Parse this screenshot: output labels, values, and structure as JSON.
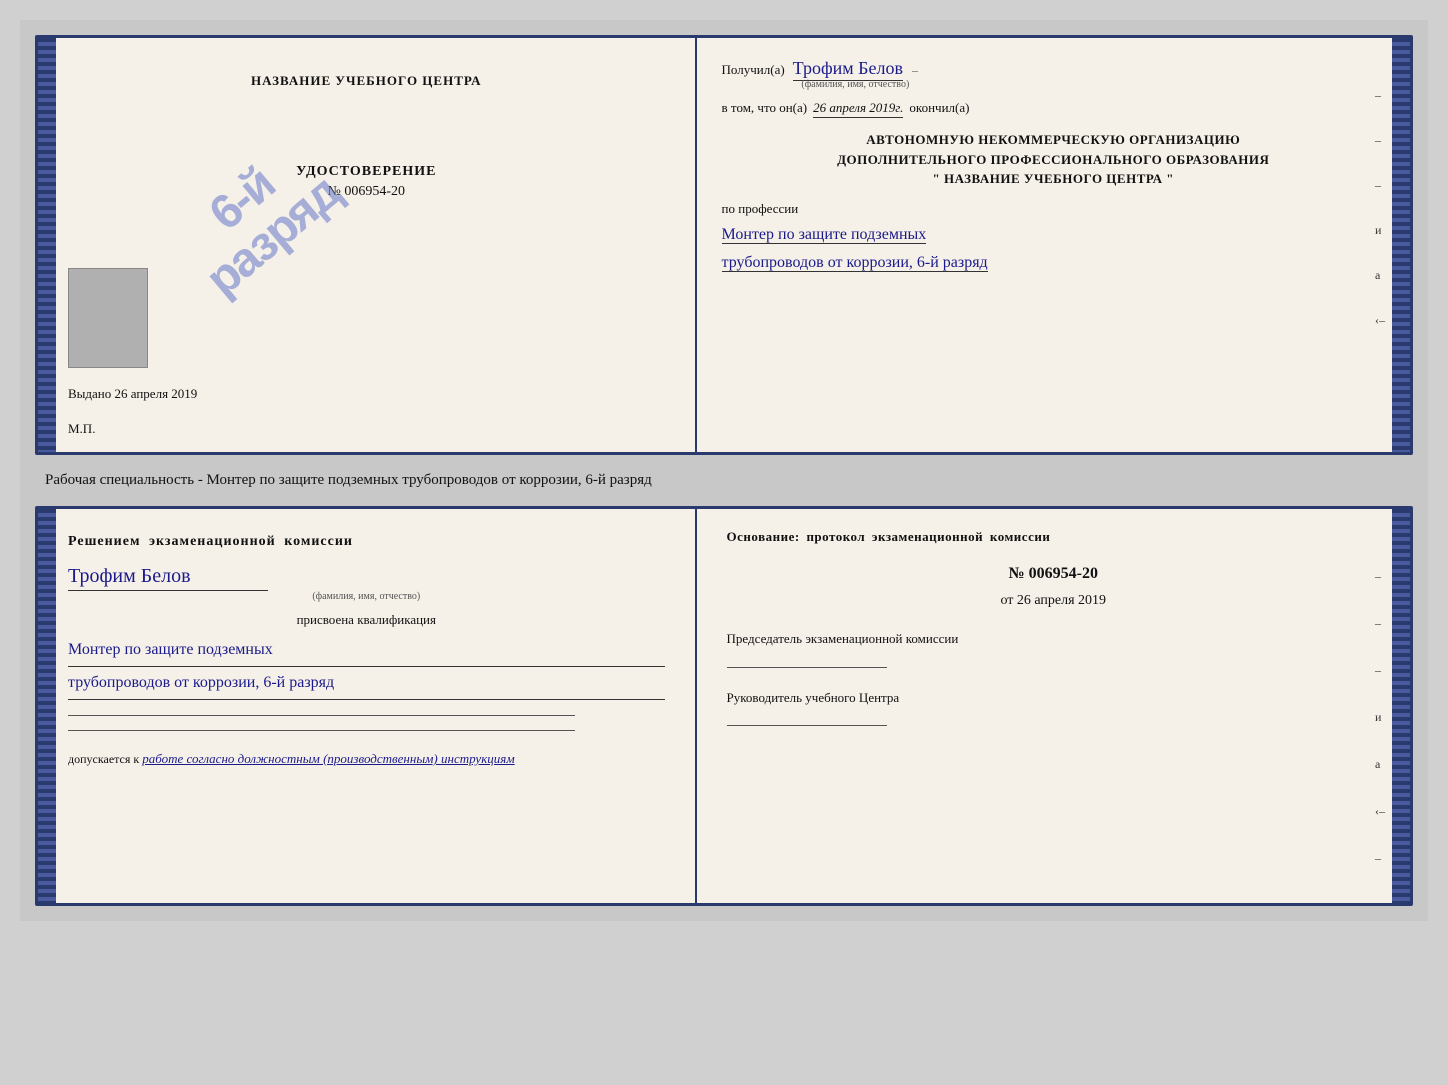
{
  "top_cert": {
    "left": {
      "title": "НАЗВАНИЕ УЧЕБНОГО ЦЕНТРА",
      "stamp_line1": "6-й",
      "stamp_line2": "разряд",
      "udost_title": "УДОСТОВЕРЕНИЕ",
      "udost_number": "№ 006954-20",
      "vydano_label": "Выдано",
      "vydano_date": "26 апреля 2019",
      "mp_label": "М.П."
    },
    "right": {
      "poluchil_label": "Получил(a)",
      "recipient_name": "Трофим Белов",
      "fio_hint": "(фамилия, имя, отчество)",
      "vtom_label": "в том, что он(а)",
      "date_written": "26 апреля 2019г.",
      "okonchil_label": "окончил(а)",
      "org_line1": "АВТОНОМНУЮ НЕКОММЕРЧЕСКУЮ ОРГАНИЗАЦИЮ",
      "org_line2": "ДОПОЛНИТЕЛЬНОГО ПРОФЕССИОНАЛЬНОГО ОБРАЗОВАНИЯ",
      "org_line3": "\"  НАЗВАНИЕ УЧЕБНОГО ЦЕНТРА  \"",
      "po_professii_label": "по профессии",
      "profession_line1": "Монтер по защите подземных",
      "profession_line2": "трубопроводов от коррозии, 6-й разряд",
      "dash1": "–",
      "dash2": "–",
      "dash3": "–",
      "i_label": "и",
      "a_label": "а",
      "arrow_label": "‹–"
    }
  },
  "middle": {
    "text": "Рабочая специальность - Монтер по защите подземных трубопроводов от коррозии, 6-й разряд"
  },
  "bottom_cert": {
    "left": {
      "resheniye_title": "Решением  экзаменационной  комиссии",
      "name": "Трофим Белов",
      "fio_hint": "(фамилия, имя, отчество)",
      "prisvoena_label": "присвоена квалификация",
      "qual_line1": "Монтер по защите подземных",
      "qual_line2": "трубопроводов от коррозии, 6-й разряд",
      "dopuskaetsya_label": "допускается к",
      "dopuskaetsya_italic": "работе согласно должностным (производственным) инструкциям"
    },
    "right": {
      "osnovaniye_label": "Основание:  протокол  экзаменационной  комиссии",
      "protocol_number": "№  006954-20",
      "ot_label": "от",
      "ot_date": "26 апреля 2019",
      "predsedatel_title": "Председатель экзаменационной комиссии",
      "rukovoditel_title": "Руководитель учебного Центра",
      "dash1": "–",
      "dash2": "–",
      "dash3": "–",
      "i_label": "и",
      "a_label": "а",
      "arrow_label": "‹–"
    }
  }
}
